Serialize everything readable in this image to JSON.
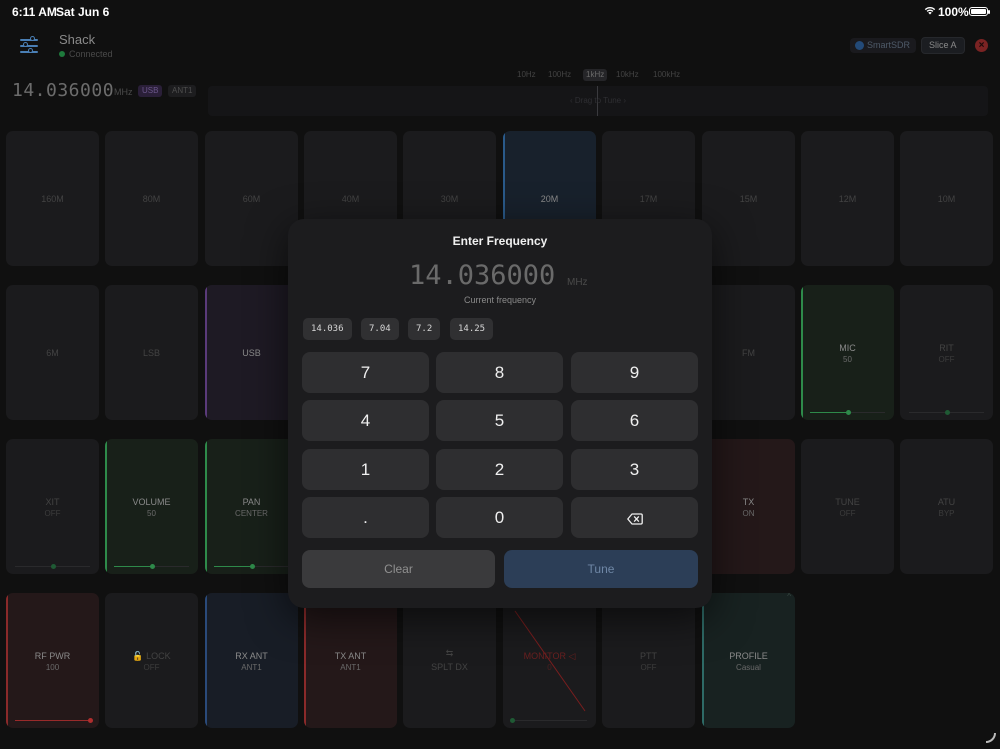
{
  "status_bar": {
    "time": "6:11 AM",
    "date": "Sat Jun 6",
    "battery": "100%"
  },
  "header": {
    "radio_name": "Shack",
    "connection_status": "Connected",
    "smartsdr_label": "SmartSDR",
    "slice_label": "Slice A"
  },
  "display": {
    "frequency": "14.036000",
    "unit": "MHz",
    "mode": "USB",
    "antenna": "ANT1",
    "steps": [
      "10Hz",
      "100Hz",
      "1kHz",
      "10kHz",
      "100kHz"
    ],
    "active_step": "1kHz",
    "tune_hint": "‹ Drag to Tune ›"
  },
  "tiles": {
    "row1": [
      "160M",
      "80M",
      "60M",
      "40M",
      "30M",
      "20M",
      "17M",
      "15M",
      "12M",
      "10M"
    ],
    "row2": [
      {
        "label": "6M"
      },
      {
        "label": "LSB"
      },
      {
        "label": "USB"
      },
      {
        "label": "FM"
      },
      {
        "label": "MIC",
        "value": "50"
      },
      {
        "label": "RIT",
        "value": "OFF"
      }
    ],
    "row3": [
      {
        "label": "XIT",
        "value": "OFF"
      },
      {
        "label": "VOLUME",
        "value": "50"
      },
      {
        "label": "PAN",
        "value": "CENTER"
      },
      {
        "label": "TX",
        "value": "ON"
      },
      {
        "label": "TUNE",
        "value": "OFF"
      },
      {
        "label": "ATU",
        "value": "BYP"
      }
    ],
    "row4": [
      {
        "label": "RF PWR",
        "value": "100"
      },
      {
        "label": "LOCK",
        "value": "OFF"
      },
      {
        "label": "RX ANT",
        "value": "ANT1"
      },
      {
        "label": "TX ANT",
        "value": "ANT1"
      },
      {
        "label": "SPLT DX"
      },
      {
        "label": "MONITOR",
        "value": "0"
      },
      {
        "label": "PTT",
        "value": "OFF"
      },
      {
        "label": "PROFILE",
        "value": "Casual"
      }
    ],
    "levels": {
      "mic": 0.5,
      "rit": 0.5,
      "xit": 0.5,
      "volume": 0.5,
      "pan": 0.5,
      "rf_pwr": 1.0,
      "monitor": 0.0
    }
  },
  "modal": {
    "title": "Enter Frequency",
    "frequency": "14.036000",
    "unit": "MHz",
    "subtitle": "Current frequency",
    "presets": [
      "14.036",
      "7.04",
      "7.2",
      "14.25"
    ],
    "keys": [
      "7",
      "8",
      "9",
      "4",
      "5",
      "6",
      "1",
      "2",
      "3",
      ".",
      "0"
    ],
    "backspace_icon": "delete-left-icon",
    "clear_label": "Clear",
    "tune_label": "Tune"
  },
  "colors": {
    "accent_blue": "#2c3e57",
    "band_active": "#2a5a8a",
    "green": "#2e8a4a",
    "red": "#8a2a2a",
    "purple": "#5a3a7a",
    "teal": "#2e6a66"
  }
}
